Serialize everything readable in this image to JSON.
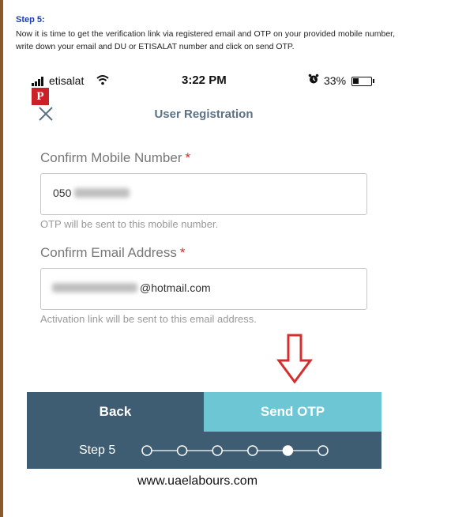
{
  "article": {
    "step_heading": "Step 5:",
    "step_description": "Now it is time to get the verification link via registered email and OTP on your provided mobile number, write down your email and DU or ETISALAT number and click on send OTP."
  },
  "status_bar": {
    "carrier": "etisalat",
    "time": "3:22 PM",
    "battery_percent": "33%",
    "battery_level": 0.33
  },
  "screen": {
    "title": "User Registration",
    "mobile": {
      "label": "Confirm Mobile Number",
      "required_mark": "*",
      "value_visible": "050",
      "help": "OTP will be sent to this mobile number."
    },
    "email": {
      "label": "Confirm Email Address",
      "required_mark": "*",
      "value_visible": "@hotmail.com",
      "help": "Activation link will be sent to this email address."
    },
    "buttons": {
      "back": "Back",
      "send_otp": "Send OTP"
    },
    "stepper": {
      "label": "Step 5",
      "total_steps": 6,
      "current_step": 5
    }
  },
  "colors": {
    "accent_dark": "#3f5d72",
    "accent_light": "#6cc6d4",
    "required": "#c9302c",
    "arrow": "#d32f2f"
  },
  "footer": {
    "site": "www.uaelabours.com"
  }
}
